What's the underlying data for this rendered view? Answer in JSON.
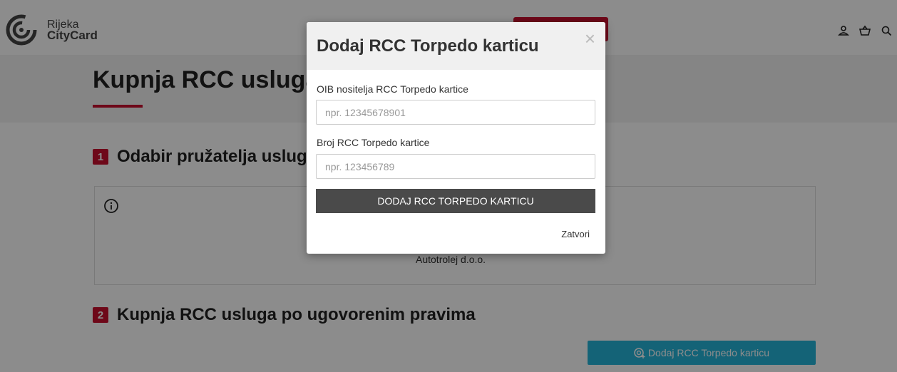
{
  "header": {
    "logo_line1": "Rijeka",
    "logo_line2": "CityCard",
    "icons": [
      "user-icon",
      "basket-icon",
      "search-icon"
    ]
  },
  "page": {
    "title": "Kupnja RCC usluga"
  },
  "sections": [
    {
      "number": "1",
      "title": "Odabir pružatelja usluge"
    },
    {
      "number": "2",
      "title": "Kupnja RCC usluga po ugovorenim pravima"
    }
  ],
  "provider": {
    "name": "Autotrolej d.o.o."
  },
  "add_card_button_label": "Dodaj RCC Torpedo karticu",
  "modal": {
    "title": "Dodaj RCC Torpedo karticu",
    "oib_label": "OIB nositelja RCC Torpedo kartice",
    "oib_placeholder": "npr. 12345678901",
    "card_label": "Broj RCC Torpedo kartice",
    "card_placeholder": "npr. 123456789",
    "submit_label": "DODAJ RCC TORPEDO KARTICU",
    "close_label": "Zatvori"
  },
  "colors": {
    "brand_red": "#c8102e",
    "accent_blue": "#26b4d9",
    "button_dark": "#4a4a4a"
  }
}
